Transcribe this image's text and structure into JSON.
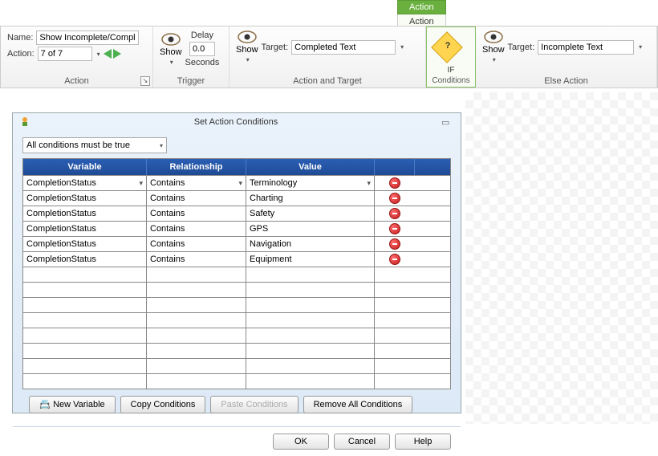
{
  "tab": {
    "top": "Action",
    "sub": "Action"
  },
  "ribbon": {
    "action": {
      "name_label": "Name:",
      "name_value": "Show Incomplete/Complet",
      "action_label": "Action:",
      "action_value": "7 of 7",
      "group": "Action"
    },
    "trigger": {
      "show": "Show",
      "delay_label": "Delay",
      "delay_value": "0.0",
      "seconds": "Seconds",
      "group": "Trigger"
    },
    "actionTarget": {
      "show": "Show",
      "target_label": "Target:",
      "target_value": "Completed Text",
      "group": "Action and Target"
    },
    "conditions": {
      "if": "IF",
      "group": "Conditions"
    },
    "elseAction": {
      "show": "Show",
      "target_label": "Target:",
      "target_value": "Incomplete Text",
      "group": "Else Action"
    }
  },
  "dialog": {
    "title": "Set Action Conditions",
    "all_conditions": "All conditions must be true",
    "headers": {
      "variable": "Variable",
      "relationship": "Relationship",
      "value": "Value"
    },
    "rows": [
      {
        "variable": "CompletionStatus",
        "relationship": "Contains",
        "value": "Terminology"
      },
      {
        "variable": "CompletionStatus",
        "relationship": "Contains",
        "value": "Charting"
      },
      {
        "variable": "CompletionStatus",
        "relationship": "Contains",
        "value": "Safety"
      },
      {
        "variable": "CompletionStatus",
        "relationship": "Contains",
        "value": "GPS"
      },
      {
        "variable": "CompletionStatus",
        "relationship": "Contains",
        "value": "Navigation"
      },
      {
        "variable": "CompletionStatus",
        "relationship": "Contains",
        "value": "Equipment"
      }
    ],
    "buttons": {
      "new_variable": "New Variable",
      "copy": "Copy Conditions",
      "paste": "Paste Conditions",
      "remove_all": "Remove All Conditions",
      "ok": "OK",
      "cancel": "Cancel",
      "help": "Help"
    }
  }
}
